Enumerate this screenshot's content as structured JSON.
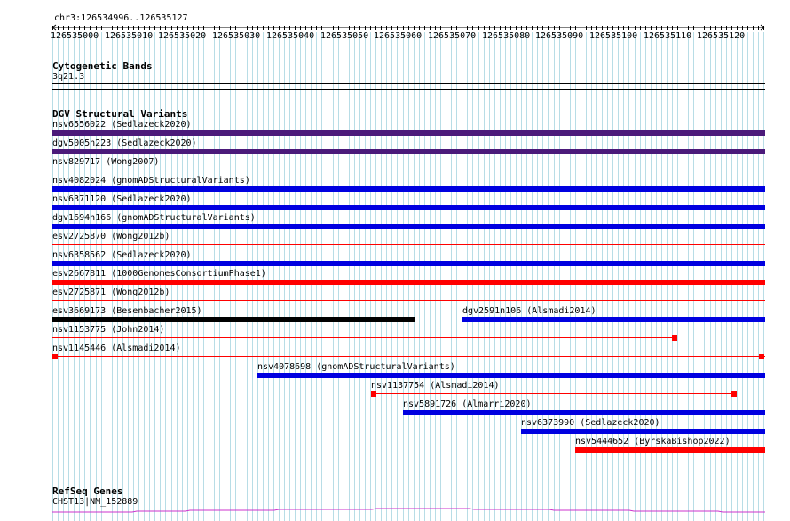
{
  "ruler": {
    "location": "chr3:126534996..126535127",
    "ticks": [
      "126535000",
      "126535010",
      "126535020",
      "126535030",
      "126535040",
      "126535050",
      "126535060",
      "126535070",
      "126535080",
      "126535090",
      "126535100",
      "126535110",
      "126535120"
    ]
  },
  "cytoband": {
    "title": "Cytogenetic Bands",
    "band": "3q21.3"
  },
  "dgv": {
    "title": "DGV Structural Variants",
    "features": [
      {
        "label": "nsv6556022 (Sedlazeck2020)",
        "color": "#4b1a7a",
        "style": "thick"
      },
      {
        "label": "dgv5005n223 (Sedlazeck2020)",
        "color": "#4b1a7a",
        "style": "thick"
      },
      {
        "label": "nsv829717 (Wong2007)",
        "color": "#ff0000",
        "style": "thin"
      },
      {
        "label": "nsv4082024 (gnomADStructuralVariants)",
        "color": "#0000e0",
        "style": "thick"
      },
      {
        "label": "nsv6371120 (Sedlazeck2020)",
        "color": "#0000e0",
        "style": "thick"
      },
      {
        "label": "dgv1694n166 (gnomADStructuralVariants)",
        "color": "#0000e0",
        "style": "thick"
      },
      {
        "label": "esv2725870 (Wong2012b)",
        "color": "#ff0000",
        "style": "thin"
      },
      {
        "label": "nsv6358562 (Sedlazeck2020)",
        "color": "#0000e0",
        "style": "thick"
      },
      {
        "label": "esv2667811 (1000GenomesConsortiumPhase1)",
        "color": "#ff0000",
        "style": "thick"
      },
      {
        "label": "esv2725871 (Wong2012b)",
        "color": "#ff0000",
        "style": "thin"
      },
      {
        "label": "esv3669173 (Besenbacher2015)",
        "color": "#000000",
        "style": "thick"
      },
      {
        "label": "dgv2591n106 (Alsmadi2014)",
        "color": "#0000e0",
        "style": "thick"
      },
      {
        "label": "nsv1153775 (John2014)",
        "color": "#ff0000",
        "style": "thin-endbox"
      },
      {
        "label": "nsv1145446 (Alsmadi2014)",
        "color": "#ff0000",
        "style": "thin-boxes"
      },
      {
        "label": "nsv4078698 (gnomADStructuralVariants)",
        "color": "#0000e0",
        "style": "thick"
      },
      {
        "label": "nsv1137754 (Alsmadi2014)",
        "color": "#ff0000",
        "style": "thin-boxes"
      },
      {
        "label": "nsv5891726 (Almarri2020)",
        "color": "#0000e0",
        "style": "thick"
      },
      {
        "label": "nsv6373990 (Sedlazeck2020)",
        "color": "#0000e0",
        "style": "thick"
      },
      {
        "label": "nsv5444652 (ByrskaBishop2022)",
        "color": "#ff0000",
        "style": "thick"
      }
    ]
  },
  "refseq": {
    "title": "RefSeq Genes",
    "gene": "CHST13|NM_152889",
    "color": "#cc33cc"
  }
}
